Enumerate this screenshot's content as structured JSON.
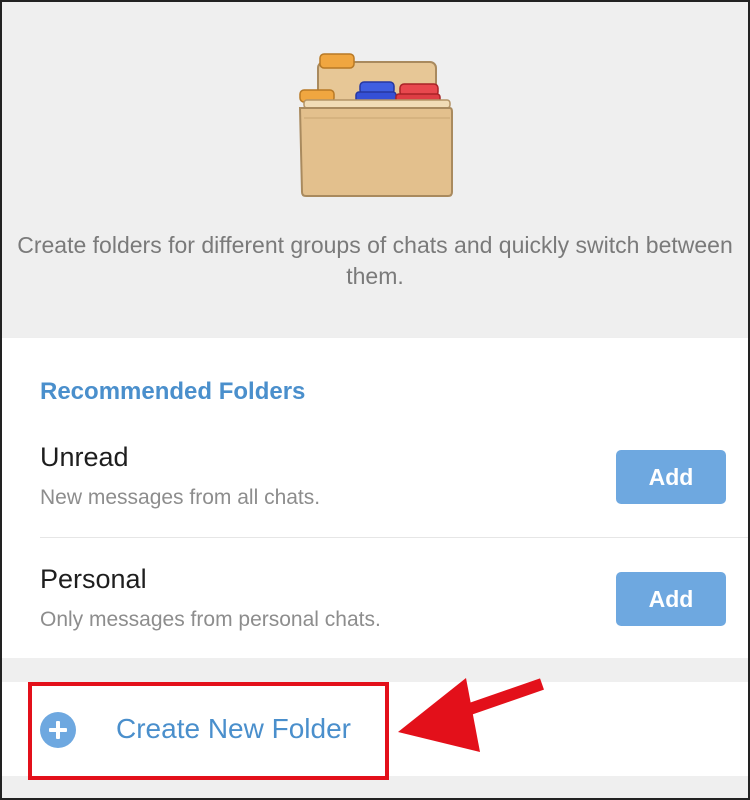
{
  "hero": {
    "illustration_icon": "folder-cabinet-icon",
    "description": "Create folders for different groups of chats and quickly switch between them."
  },
  "recommended": {
    "title": "Recommended Folders",
    "items": [
      {
        "name": "Unread",
        "description": "New messages from all chats.",
        "button_label": "Add"
      },
      {
        "name": "Personal",
        "description": "Only messages from personal chats.",
        "button_label": "Add"
      }
    ]
  },
  "create_folder": {
    "label": "Create New Folder",
    "icon": "plus-circle-icon"
  },
  "annotation": {
    "box_color": "#e3101a",
    "arrow_color": "#e3101a",
    "arrow_icon": "red-arrow-icon"
  },
  "colors": {
    "accent": "#4a8fcc",
    "button": "#6ea8e0",
    "background": "#efefef"
  }
}
